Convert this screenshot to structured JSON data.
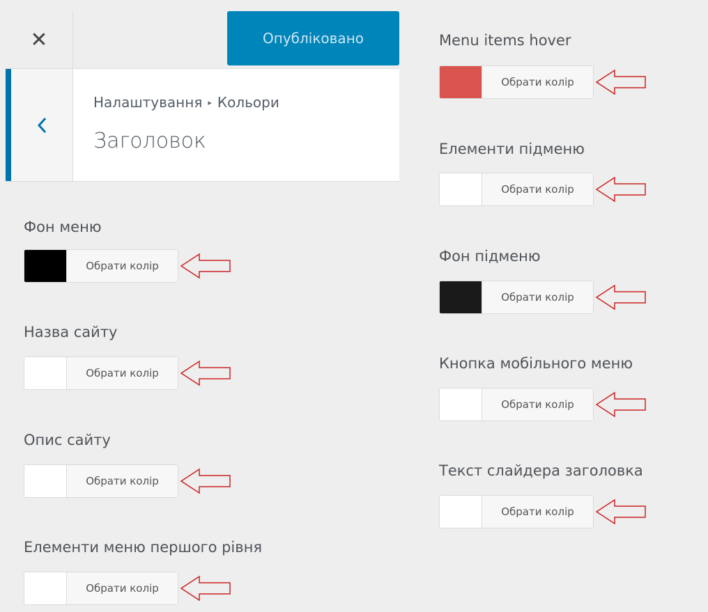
{
  "header": {
    "close_glyph": "✕",
    "publish_label": "Опубліковано",
    "breadcrumb_parent": "Налаштування",
    "breadcrumb_sep": "▸",
    "breadcrumb_current": "Кольори",
    "title": "Заголовок"
  },
  "controls_left": [
    {
      "label": "Фон меню",
      "button": "Обрати колір",
      "color": "#000000"
    },
    {
      "label": "Назва сайту",
      "button": "Обрати колір",
      "color": "#ffffff"
    },
    {
      "label": "Опис сайту",
      "button": "Обрати колір",
      "color": "#ffffff"
    },
    {
      "label": "Елементи меню першого рівня",
      "button": "Обрати колір",
      "color": "#ffffff"
    }
  ],
  "controls_right": [
    {
      "label": "Menu items hover",
      "button": "Обрати колір",
      "color": "#d9534f"
    },
    {
      "label": "Елементи підменю",
      "button": "Обрати колір",
      "color": "#ffffff"
    },
    {
      "label": "Фон підменю",
      "button": "Обрати колір",
      "color": "#1a1a1a"
    },
    {
      "label": "Кнопка мобільного меню",
      "button": "Обрати колір",
      "color": "#ffffff"
    },
    {
      "label": "Текст слайдера заголовка",
      "button": "Обрати колір",
      "color": "#ffffff"
    }
  ],
  "colors": {
    "accent": "#0073aa",
    "publish_bg": "#0085ba",
    "arrow": "#cc2222"
  }
}
